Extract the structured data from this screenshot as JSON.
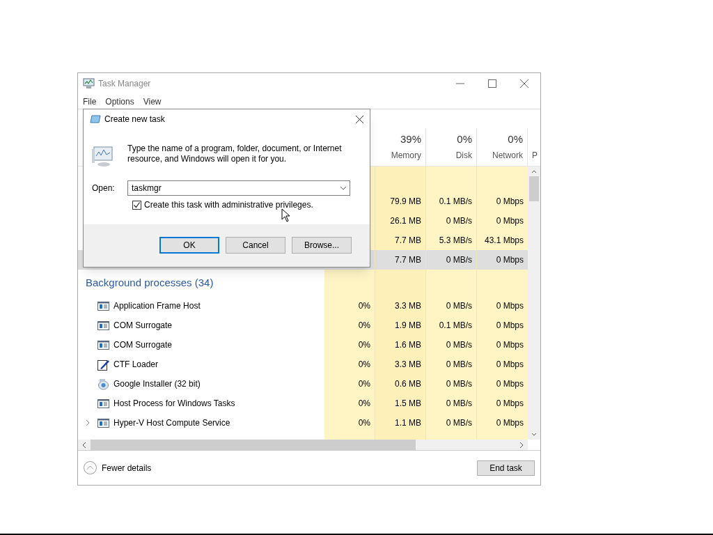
{
  "window": {
    "title": "Task Manager"
  },
  "menu": [
    "File",
    "Options",
    "View"
  ],
  "columns": [
    {
      "percent": "39%",
      "label": "Memory"
    },
    {
      "percent": "0%",
      "label": "Disk"
    },
    {
      "percent": "0%",
      "label": "Network"
    },
    {
      "label": "P"
    }
  ],
  "apps_rows": [
    {
      "memory": "79.9 MB",
      "disk": "0.1 MB/s",
      "network": "0 Mbps",
      "selected": false
    },
    {
      "memory": "26.1 MB",
      "disk": "0 MB/s",
      "network": "0 Mbps",
      "selected": false
    },
    {
      "memory": "7.7 MB",
      "disk": "5.3 MB/s",
      "network": "43.1 Mbps",
      "selected": false
    },
    {
      "memory": "7.7 MB",
      "disk": "0 MB/s",
      "network": "0 Mbps",
      "selected": true
    }
  ],
  "background_group": {
    "title": "Background processes (34)",
    "rows": [
      {
        "name": "Application Frame Host",
        "kind": "window",
        "expandable": false,
        "cpu": "0%",
        "memory": "3.3 MB",
        "disk": "0 MB/s",
        "network": "0 Mbps"
      },
      {
        "name": "COM Surrogate",
        "kind": "window",
        "expandable": false,
        "cpu": "0%",
        "memory": "1.9 MB",
        "disk": "0.1 MB/s",
        "network": "0 Mbps"
      },
      {
        "name": "COM Surrogate",
        "kind": "window",
        "expandable": false,
        "cpu": "0%",
        "memory": "1.6 MB",
        "disk": "0 MB/s",
        "network": "0 Mbps"
      },
      {
        "name": "CTF Loader",
        "kind": "pen",
        "expandable": false,
        "cpu": "0%",
        "memory": "3.3 MB",
        "disk": "0 MB/s",
        "network": "0 Mbps"
      },
      {
        "name": "Google Installer (32 bit)",
        "kind": "installer",
        "expandable": false,
        "cpu": "0%",
        "memory": "0.6 MB",
        "disk": "0 MB/s",
        "network": "0 Mbps"
      },
      {
        "name": "Host Process for Windows Tasks",
        "kind": "window",
        "expandable": false,
        "cpu": "0%",
        "memory": "1.5 MB",
        "disk": "0 MB/s",
        "network": "0 Mbps"
      },
      {
        "name": "Hyper-V Host Compute Service",
        "kind": "window",
        "expandable": true,
        "cpu": "0%",
        "memory": "1.1 MB",
        "disk": "0 MB/s",
        "network": "0 Mbps"
      }
    ]
  },
  "footer": {
    "fewer_details": "Fewer details",
    "end_task": "End task"
  },
  "dialog": {
    "title": "Create new task",
    "message": "Type the name of a program, folder, document, or Internet resource, and Windows will open it for you.",
    "open_label": "Open:",
    "open_value": "taskmgr",
    "admin_checkbox": {
      "label": "Create this task with administrative privileges.",
      "checked": true
    },
    "buttons": [
      {
        "label": "OK",
        "default": true
      },
      {
        "label": "Cancel",
        "default": false
      },
      {
        "label": "Browse...",
        "default": false
      }
    ]
  }
}
